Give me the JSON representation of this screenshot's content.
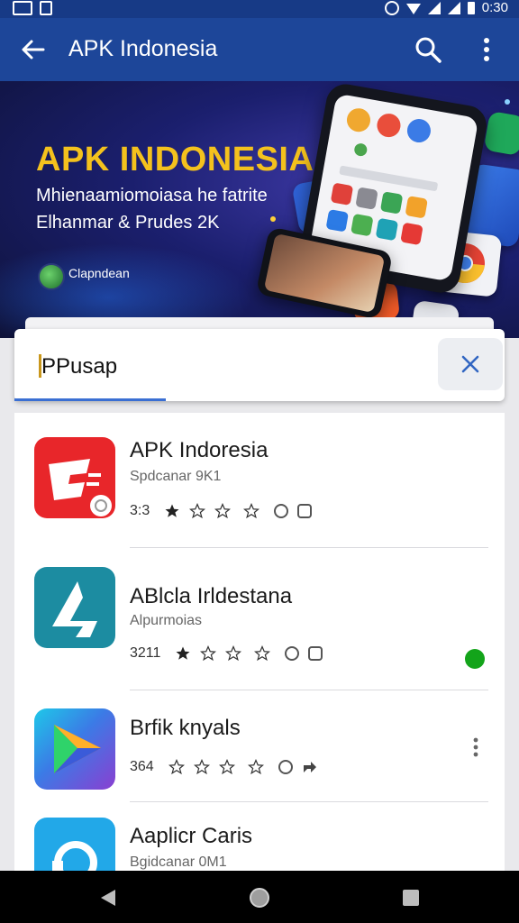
{
  "status_bar": {
    "time": "0:30"
  },
  "app_bar": {
    "title": "APK Indonesia"
  },
  "banner": {
    "headline": "APK INDONESIA",
    "subtitle_line1": "Mhienaamiomoiasa he fatrite",
    "subtitle_line2": "Elhanmar & Prudes 2K",
    "badge_label": "Clapndean"
  },
  "search": {
    "query": "PPusap"
  },
  "apps": [
    {
      "name": "APK Indoresia",
      "developer": "Spdcanar 9K1",
      "rating": "3:3",
      "stars_filled": 1,
      "icon": "red-ticket-app-icon"
    },
    {
      "name": "ABlcla Irldestana",
      "developer": "Alpurmoias",
      "rating": "3211",
      "stars_filled": 1,
      "icon": "teal-a-logo-app-icon"
    },
    {
      "name": "Brfik knyals",
      "developer": "",
      "rating": "364",
      "stars_filled": 0,
      "icon": "play-triangle-app-icon"
    },
    {
      "name": "Aaplicr Caris",
      "developer": "Bgidcanar 0M1",
      "rating": "",
      "stars_filled": 0,
      "icon": "blue-circle-app-icon"
    }
  ],
  "colors": {
    "app_bar": "#1d4699",
    "banner_headline": "#f4c21d",
    "accent": "#3a6fd3",
    "install_badge": "#13a41a"
  }
}
